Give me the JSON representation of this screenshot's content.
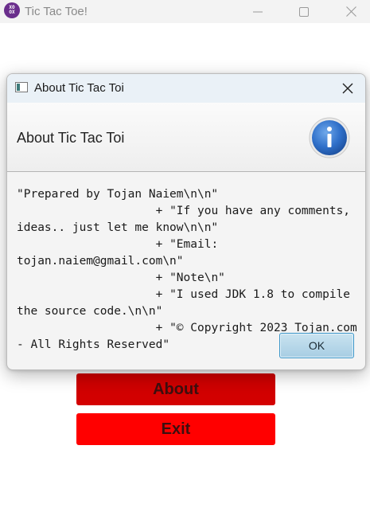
{
  "window": {
    "title": "Tic Tac Toe!",
    "icon": "xo-game-icon",
    "icon_text": "XO\nOX",
    "controls": [
      "minimize-icon",
      "maximize-icon",
      "close-icon"
    ]
  },
  "main": {
    "buttons": [
      {
        "label": "About",
        "color": "#cc0000"
      },
      {
        "label": "Exit",
        "color": "#ff0000"
      }
    ]
  },
  "dialog": {
    "title": "About Tic Tac Toi",
    "header_title": "About Tic Tac Toi",
    "icon": "info-icon",
    "content": "\"Prepared by Tojan Naiem\\n\\n\"\n                    + \"If you have any comments, ideas.. just let me know\\n\\n\"\n                    + \"Email:   tojan.naiem@gmail.com\\n\"\n                    + \"Note\\n\"\n                    + \"I used JDK 1.8 to compile the source code.\\n\\n\"\n                    + \"© Copyright 2023 Tojan.com - All Rights Reserved\"",
    "ok_label": "OK"
  },
  "colors": {
    "about_button": "#cc0000",
    "exit_button": "#ff0000",
    "ok_accent": "#3a95c8",
    "app_icon": "#6a2e8c"
  }
}
